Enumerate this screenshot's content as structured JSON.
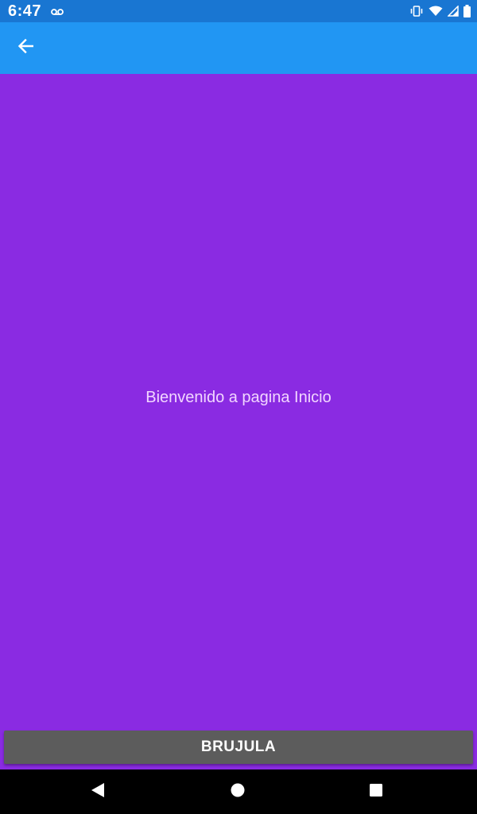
{
  "status_bar": {
    "time": "6:47",
    "icons": [
      "voicemail-icon",
      "vibrate-icon",
      "wifi-icon",
      "cell-signal-icon",
      "battery-icon"
    ]
  },
  "app_bar": {
    "back_icon": "arrow-back-icon",
    "color": "#2196f3"
  },
  "main": {
    "welcome_text": "Bienvenido a pagina Inicio",
    "background_color": "#8a2be2",
    "button_label": "BRUJULA"
  },
  "nav_bar": {
    "icons": [
      "nav-back-icon",
      "nav-home-icon",
      "nav-recents-icon"
    ]
  }
}
